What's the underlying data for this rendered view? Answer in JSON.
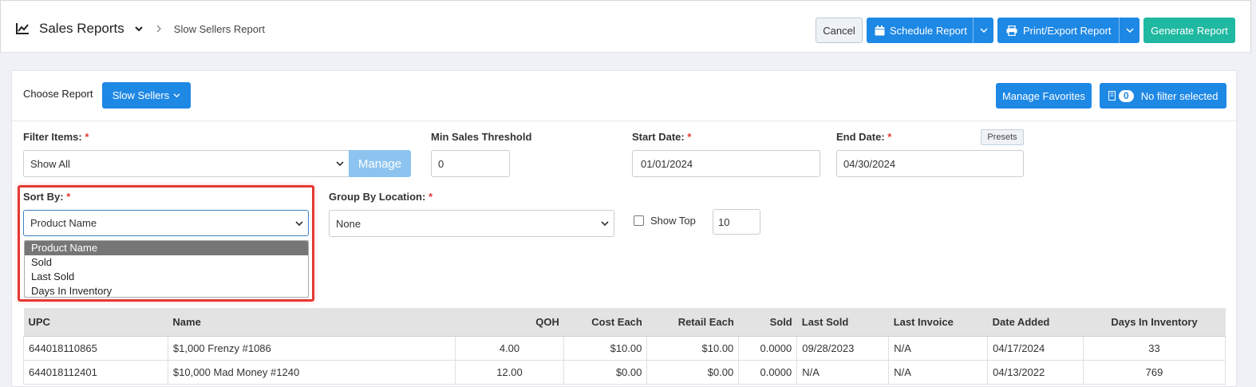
{
  "header": {
    "title": "Sales Reports",
    "breadcrumb_current": "Slow Sellers Report",
    "cancel_label": "Cancel",
    "schedule_label": "Schedule Report",
    "print_label": "Print/Export Report",
    "generate_label": "Generate Report"
  },
  "report_bar": {
    "choose_label": "Choose Report",
    "report_button": "Slow Sellers",
    "manage_favorites": "Manage Favorites",
    "filter_count": "0",
    "filter_label": "No filter selected"
  },
  "filters": {
    "filter_items_label": "Filter Items:",
    "filter_items_value": "Show All",
    "manage_label": "Manage",
    "min_threshold_label": "Min Sales Threshold",
    "min_threshold_value": "0",
    "start_date_label": "Start Date:",
    "start_date_value": "01/01/2024",
    "end_date_label": "End Date:",
    "end_date_value": "04/30/2024",
    "presets_label": "Presets",
    "sort_by_label": "Sort By:",
    "sort_by_value": "Product Name",
    "sort_options": [
      "Product Name",
      "Sold",
      "Last Sold",
      "Days In Inventory"
    ],
    "group_by_label": "Group By Location:",
    "group_by_value": "None",
    "show_top_label": "Show Top",
    "show_top_value": "10",
    "required_mark": "*"
  },
  "table": {
    "columns": [
      "UPC",
      "Name",
      "QOH",
      "Cost Each",
      "Retail Each",
      "Sold",
      "Last Sold",
      "Last Invoice",
      "Date Added",
      "Days In Inventory"
    ],
    "rows": [
      [
        "644018110865",
        "$1,000 Frenzy #1086",
        "4.00",
        "$10.00",
        "$10.00",
        "0.0000",
        "09/28/2023",
        "N/A",
        "04/17/2024",
        "33"
      ],
      [
        "644018112401",
        "$10,000 Mad Money #1240",
        "12.00",
        "$0.00",
        "$0.00",
        "0.0000",
        "N/A",
        "N/A",
        "04/13/2022",
        "769"
      ]
    ]
  },
  "colors": {
    "primary": "#1e88e5",
    "accent": "#1fb8a0",
    "highlight": "#e53935"
  }
}
